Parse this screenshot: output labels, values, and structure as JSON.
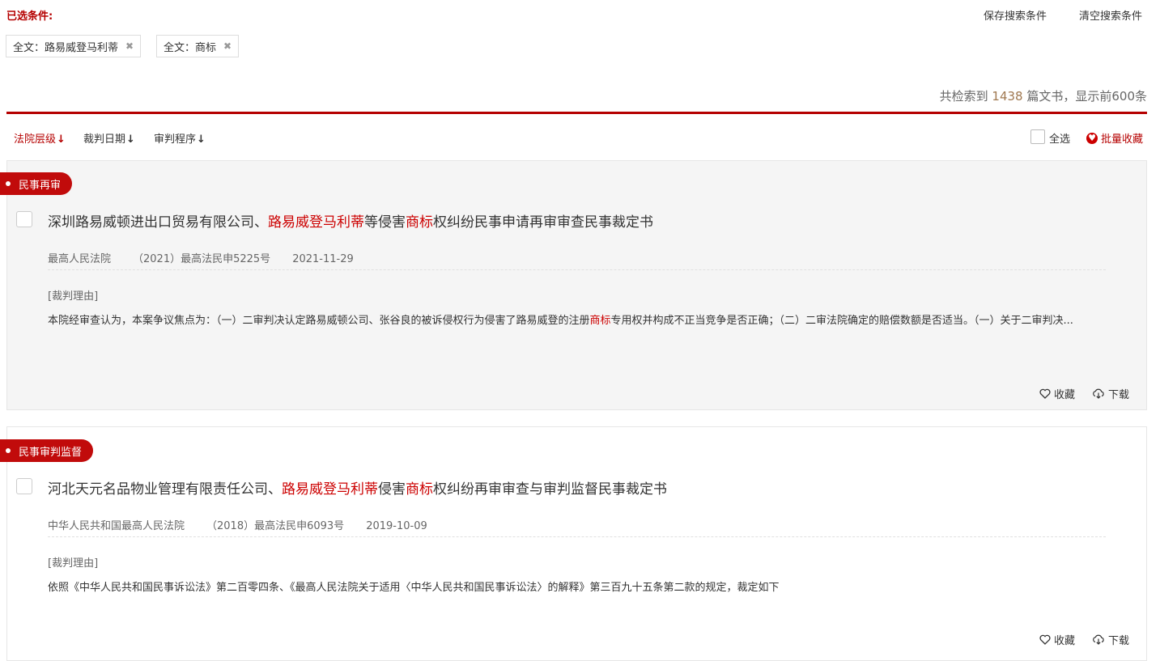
{
  "filters": {
    "label": "已选条件:",
    "save_search": "保存搜索条件",
    "clear_search": "清空搜索条件",
    "tags": [
      {
        "text": "全文：路易威登马利蒂",
        "remove": "✖"
      },
      {
        "text": "全文：商标",
        "remove": "✖"
      }
    ]
  },
  "results": {
    "prefix": "共检索到 ",
    "count": "1438",
    "suffix": " 篇文书，显示前600条"
  },
  "sort": {
    "items": [
      {
        "label": "法院层级",
        "arrow": "↓"
      },
      {
        "label": "裁判日期",
        "arrow": "↓"
      },
      {
        "label": "审判程序",
        "arrow": "↓"
      }
    ],
    "select_all": "全选",
    "batch_fav_icon": "heart-icon",
    "batch_fav": "批量收藏"
  },
  "cards": [
    {
      "tag": "民事再审",
      "title": {
        "p1": "深圳路易威顿进出口贸易有限公司、",
        "h1": "路易威登马利蒂",
        "p2": "等侵害",
        "h2": "商标",
        "p3": "权纠纷民事申请再审审查民事裁定书"
      },
      "court": "最高人民法院",
      "case_no": "（2021）最高法民申5225号",
      "date": "2021-11-29",
      "reason_label": "[裁判理由]",
      "excerpt": {
        "p1": "本院经审查认为，本案争议焦点为：（一）二审判决认定路易威顿公司、张谷良的被诉侵权行为侵害了路易威登的注册",
        "h1": "商标",
        "p2": "专用权并构成不正当竞争是否正确；（二）二审法院确定的赔偿数额是否适当。（一）关于二审判决..."
      },
      "fav": "收藏",
      "download": "下载"
    },
    {
      "tag": "民事审判监督",
      "title": {
        "p1": "河北天元名品物业管理有限责任公司、",
        "h1": "路易威登马利蒂",
        "p2": "侵害",
        "h2": "商标",
        "p3": "权纠纷再审审查与审判监督民事裁定书"
      },
      "court": "中华人民共和国最高人民法院",
      "case_no": "（2018）最高法民申6093号",
      "date": "2019-10-09",
      "reason_label": "[裁判理由]",
      "excerpt": {
        "p1": "依照《中华人民共和国民事诉讼法》第二百零四条、《最高人民法院关于适用〈中华人民共和国民事诉讼法〉的解释》第三百九十五条第二款的规定，裁定如下",
        "h1": "",
        "p2": ""
      },
      "fav": "收藏",
      "download": "下载"
    }
  ],
  "colors": {
    "accent": "#b50000",
    "highlight": "#cc0000",
    "card_bg": "#f5f5f5"
  }
}
